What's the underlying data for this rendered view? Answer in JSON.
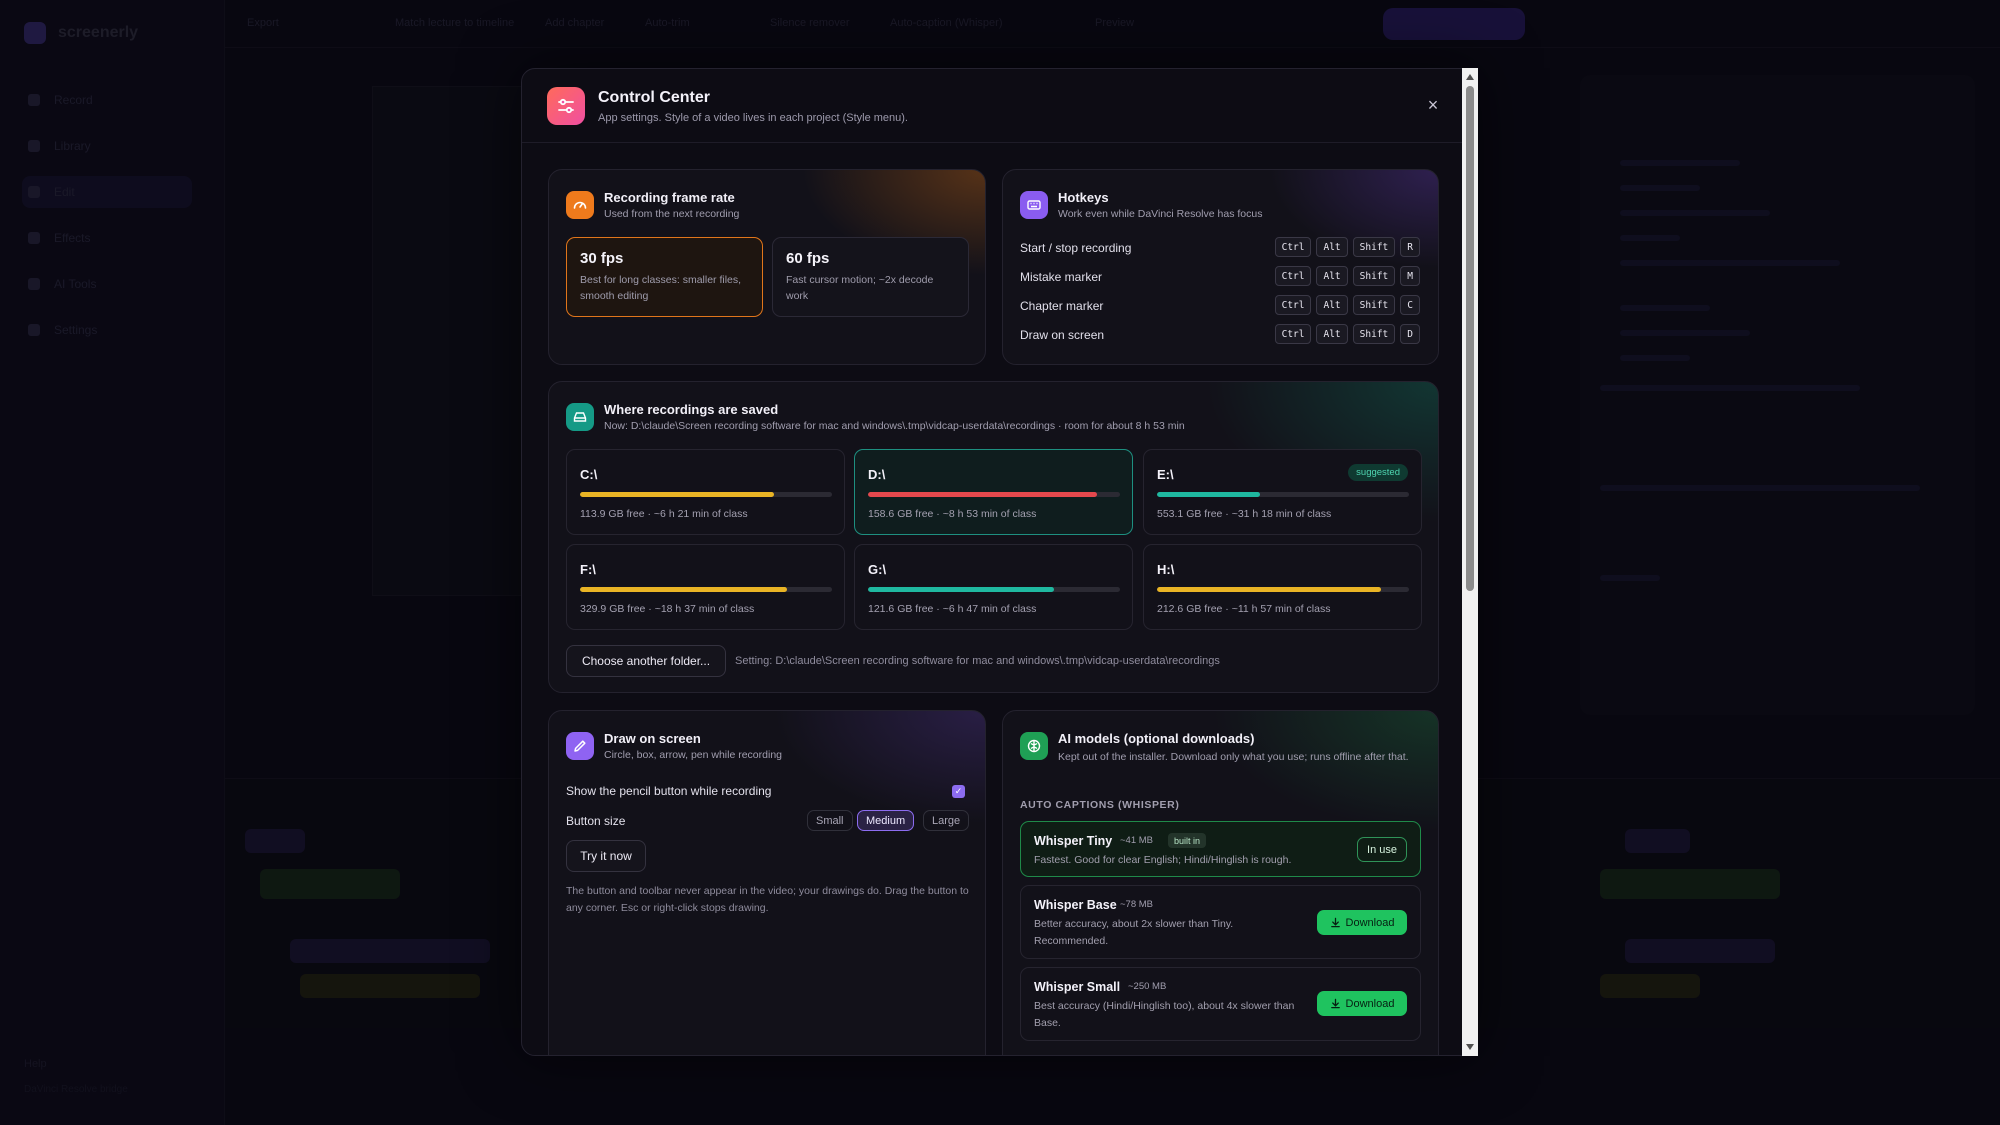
{
  "background_app": {
    "app_name": "screenerly",
    "nav": [
      "Record",
      "Library",
      "Edit",
      "Effects",
      "AI Tools",
      "Settings"
    ],
    "footer_label": "Help",
    "footer_sub": "DaVinci Resolve bridge",
    "top_items": [
      "Export",
      "Match lecture to timeline",
      "Add chapter",
      "Auto-trim",
      "Silence remover",
      "Auto-caption (Whisper)",
      "Preview"
    ],
    "top_button": "Render & Export"
  },
  "modal": {
    "title": "Control Center",
    "subtitle": "App settings. Style of a video lives in each project (Style menu).",
    "close_icon": "×"
  },
  "frame_rate": {
    "title": "Recording frame rate",
    "subtitle": "Used from the next recording",
    "options": [
      {
        "label": "30 fps",
        "desc": "Best for long classes: smaller files, smooth editing",
        "selected": true
      },
      {
        "label": "60 fps",
        "desc": "Fast cursor motion; ~2x decode work",
        "selected": false
      }
    ],
    "accent": "#e0751b"
  },
  "hotkeys": {
    "title": "Hotkeys",
    "subtitle": "Work even while DaVinci Resolve has focus",
    "rows": [
      {
        "label": "Start / stop recording",
        "keys": [
          "Ctrl",
          "Alt",
          "Shift",
          "R"
        ]
      },
      {
        "label": "Mistake marker",
        "keys": [
          "Ctrl",
          "Alt",
          "Shift",
          "M"
        ]
      },
      {
        "label": "Chapter marker",
        "keys": [
          "Ctrl",
          "Alt",
          "Shift",
          "C"
        ]
      },
      {
        "label": "Draw on screen",
        "keys": [
          "Ctrl",
          "Alt",
          "Shift",
          "D"
        ]
      }
    ]
  },
  "storage": {
    "title": "Where recordings are saved",
    "subtitle": "Now: D:\\claude\\Screen recording software for mac and windows\\.tmp\\vidcap-userdata\\recordings · room for about 8 h 53 min",
    "drives": [
      {
        "name": "C:\\",
        "info": "113.9 GB free · ~6 h 21 min of class",
        "used_fraction": 0.77,
        "color": "#e9b425",
        "selected": false,
        "badge": ""
      },
      {
        "name": "D:\\",
        "info": "158.6 GB free · ~8 h 53 min of class",
        "used_fraction": 0.91,
        "color": "#e5484d",
        "selected": true,
        "badge": ""
      },
      {
        "name": "E:\\",
        "info": "553.1 GB free · ~31 h 18 min of class",
        "used_fraction": 0.41,
        "color": "#1fb8a0",
        "selected": false,
        "badge": "suggested"
      },
      {
        "name": "F:\\",
        "info": "329.9 GB free · ~18 h 37 min of class",
        "used_fraction": 0.82,
        "color": "#e9b425",
        "selected": false,
        "badge": ""
      },
      {
        "name": "G:\\",
        "info": "121.6 GB free · ~6 h 47 min of class",
        "used_fraction": 0.74,
        "color": "#1fb8a0",
        "selected": false,
        "badge": ""
      },
      {
        "name": "H:\\",
        "info": "212.6 GB free · ~11 h 57 min of class",
        "used_fraction": 0.89,
        "color": "#e9b425",
        "selected": false,
        "badge": ""
      }
    ],
    "choose_button": "Choose another folder...",
    "setting_text": "Setting: D:\\claude\\Screen recording software for mac and windows\\.tmp\\vidcap-userdata\\recordings"
  },
  "draw": {
    "title": "Draw on screen",
    "subtitle": "Circle, box, arrow, pen while recording",
    "show_pencil_label": "Show the pencil button while recording",
    "show_pencil_checked": true,
    "button_size_label": "Button size",
    "sizes": [
      "Small",
      "Medium",
      "Large"
    ],
    "selected_size": "Medium",
    "try_button": "Try it now",
    "note": "The button and toolbar never appear in the video; your drawings do. Drag the button to any corner. Esc or right-click stops drawing."
  },
  "ai_models": {
    "title": "AI models (optional downloads)",
    "subtitle": "Kept out of the installer. Download only what you use; runs offline after that.",
    "section": "AUTO CAPTIONS (WHISPER)",
    "models": [
      {
        "name": "Whisper Tiny",
        "size": "~41 MB",
        "tag": "built in",
        "desc": "Fastest. Good for clear English; Hindi/Hinglish is rough.",
        "action": "In use"
      },
      {
        "name": "Whisper Base",
        "size": "~78 MB",
        "tag": "",
        "desc": "Better accuracy, about 2x slower than Tiny. Recommended.",
        "action": "Download"
      },
      {
        "name": "Whisper Small",
        "size": "~250 MB",
        "tag": "",
        "desc": "Best accuracy (Hindi/Hinglish too), about 4x slower than Base.",
        "action": "Download"
      }
    ]
  }
}
